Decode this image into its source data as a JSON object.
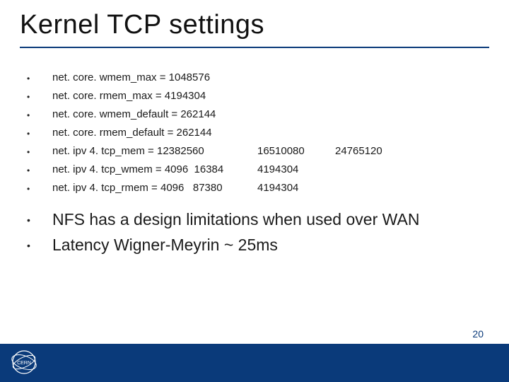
{
  "title": "Kernel TCP settings",
  "settings": [
    {
      "line": "net. core. wmem_max = 1048576"
    },
    {
      "line": "net. core. rmem_max = 4194304"
    },
    {
      "line": "net. core. wmem_default = 262144"
    },
    {
      "line": "net. core. rmem_default = 262144"
    },
    {
      "c1": "net. ipv 4. tcp_mem = 12382560",
      "c2": "16510080",
      "c3": "24765120"
    },
    {
      "c1": "net. ipv 4. tcp_wmem = 4096  16384",
      "c2": "4194304",
      "c3": ""
    },
    {
      "c1": "net. ipv 4. tcp_rmem = 4096   87380",
      "c2": "4194304",
      "c3": ""
    }
  ],
  "notes": [
    "NFS has a design limitations when used over WAN",
    "Latency Wigner-Meyrin ~ 25ms"
  ],
  "page_number": "20",
  "logo_label": "CERN",
  "colors": {
    "accent": "#0a3a7a"
  }
}
